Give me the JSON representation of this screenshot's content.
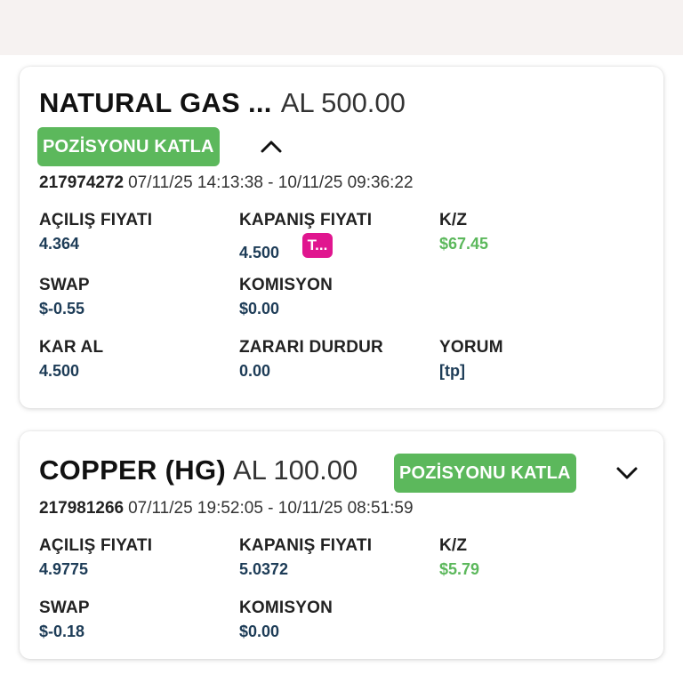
{
  "colors": {
    "accent_green": "#5cb85c",
    "value_navy": "#1d3c57",
    "badge_magenta": "#e0168f"
  },
  "positions": [
    {
      "instrument": "NATURAL GAS ...",
      "side_amount": "AL 500.00",
      "action_label": "POZİSYONU KATLA",
      "expand_icon": "chevron-up-icon",
      "position_id": "217974272",
      "date_range": "07/11/25 14:13:38 - 10/11/25 09:36:22",
      "fields": {
        "open_price": {
          "label": "AÇILIŞ FIYATI",
          "value": "4.364"
        },
        "close_price": {
          "label": "KAPANIŞ FIYATI",
          "value": "4.500",
          "badge": "T..."
        },
        "pnl": {
          "label": "K/Z",
          "value": "$67.45"
        },
        "swap": {
          "label": "SWAP",
          "value": "$-0.55"
        },
        "commission": {
          "label": "KOMISYON",
          "value": "$0.00"
        },
        "take_profit": {
          "label": "KAR AL",
          "value": "4.500"
        },
        "stop_loss": {
          "label": "ZARARI DURDUR",
          "value": "0.00"
        },
        "comment": {
          "label": "YORUM",
          "value": "[tp]"
        }
      }
    },
    {
      "instrument": "COPPER (HG)",
      "side_amount": "AL 100.00",
      "action_label": "POZİSYONU KATLA",
      "expand_icon": "chevron-down-icon",
      "position_id": "217981266",
      "date_range": "07/11/25 19:52:05 - 10/11/25 08:51:59",
      "fields": {
        "open_price": {
          "label": "AÇILIŞ FIYATI",
          "value": "4.9775"
        },
        "close_price": {
          "label": "KAPANIŞ FIYATI",
          "value": "5.0372"
        },
        "pnl": {
          "label": "K/Z",
          "value": "$5.79"
        },
        "swap": {
          "label": "SWAP",
          "value": "$-0.18"
        },
        "commission": {
          "label": "KOMISYON",
          "value": "$0.00"
        }
      }
    }
  ]
}
